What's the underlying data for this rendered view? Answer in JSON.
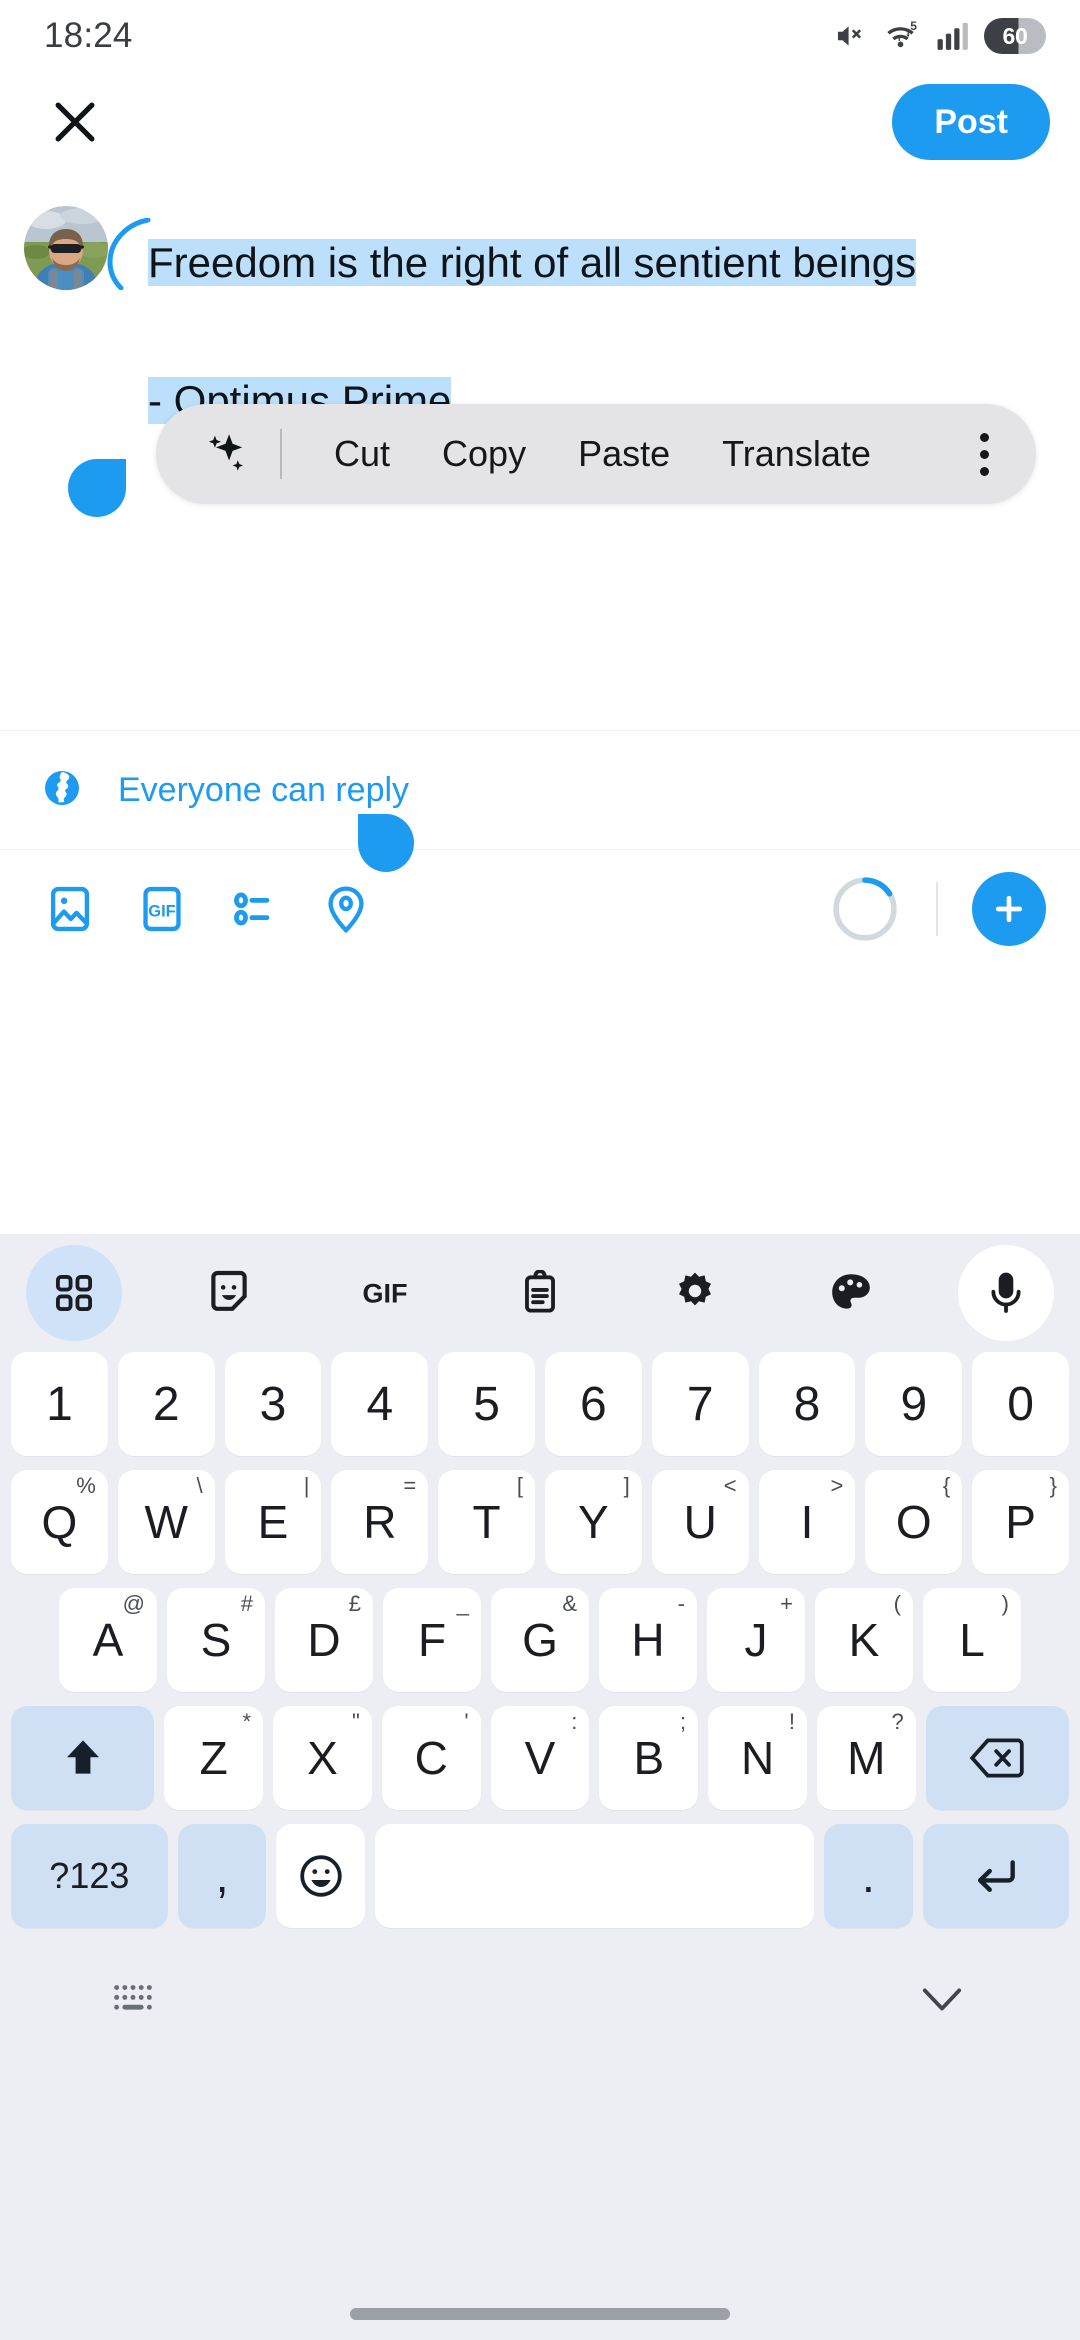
{
  "status_bar": {
    "time": "18:24",
    "battery_level": "60",
    "icons": [
      "mute-icon",
      "wifi-5g-icon",
      "signal-bars-icon",
      "battery-icon"
    ]
  },
  "header": {
    "close_label": "×",
    "post_label": "Post"
  },
  "compose": {
    "avatar_alt": "user-avatar",
    "tweet_text_line1": "Freedom is the right of all sentient beings",
    "tweet_text_line2": "- Optimus Prime",
    "selected_text": "Freedom is the right of all sentient beings\n\n- Optimus Prime",
    "selection_color": "#bcdffb",
    "handle_color": "#1d9bf0"
  },
  "selection_toolbar": {
    "ai_icon": "sparkle-icon",
    "items": [
      "Cut",
      "Copy",
      "Paste",
      "Translate"
    ],
    "overflow_icon": "more-vertical-icon",
    "background": "#e4e4e6"
  },
  "reply_settings": {
    "icon": "globe-icon",
    "label": "Everyone can reply",
    "color": "#1d9bf0"
  },
  "composer_toolbar": {
    "buttons": [
      {
        "name": "media-icon",
        "label": "Media"
      },
      {
        "name": "gif-icon",
        "label": "GIF"
      },
      {
        "name": "poll-icon",
        "label": "Poll"
      },
      {
        "name": "location-icon",
        "label": "Location"
      }
    ],
    "gif_text": "GIF",
    "progress_percent": 8,
    "add_label": "+",
    "accent": "#1d9bf0"
  },
  "keyboard": {
    "toolbar": [
      {
        "name": "apps-grid-icon",
        "active": true
      },
      {
        "name": "sticker-icon",
        "active": false
      },
      {
        "name": "gif-icon",
        "active": false,
        "text": "GIF"
      },
      {
        "name": "clipboard-icon",
        "active": false
      },
      {
        "name": "settings-gear-icon",
        "active": false
      },
      {
        "name": "theme-palette-icon",
        "active": false
      },
      {
        "name": "microphone-icon",
        "active": false
      }
    ],
    "row_numbers": [
      "1",
      "2",
      "3",
      "4",
      "5",
      "6",
      "7",
      "8",
      "9",
      "0"
    ],
    "row_q": [
      {
        "key": "Q",
        "alt": "%"
      },
      {
        "key": "W",
        "alt": "\\"
      },
      {
        "key": "E",
        "alt": "|"
      },
      {
        "key": "R",
        "alt": "="
      },
      {
        "key": "T",
        "alt": "["
      },
      {
        "key": "Y",
        "alt": "]"
      },
      {
        "key": "U",
        "alt": "<"
      },
      {
        "key": "I",
        "alt": ">"
      },
      {
        "key": "O",
        "alt": "{"
      },
      {
        "key": "P",
        "alt": "}"
      }
    ],
    "row_a": [
      {
        "key": "A",
        "alt": "@"
      },
      {
        "key": "S",
        "alt": "#"
      },
      {
        "key": "D",
        "alt": "£"
      },
      {
        "key": "F",
        "alt": "_"
      },
      {
        "key": "G",
        "alt": "&"
      },
      {
        "key": "H",
        "alt": "-"
      },
      {
        "key": "J",
        "alt": "+"
      },
      {
        "key": "K",
        "alt": "("
      },
      {
        "key": "L",
        "alt": ")"
      }
    ],
    "row_z": [
      {
        "key": "Z",
        "alt": "*"
      },
      {
        "key": "X",
        "alt": "\""
      },
      {
        "key": "C",
        "alt": "'"
      },
      {
        "key": "V",
        "alt": ":"
      },
      {
        "key": "B",
        "alt": ";"
      },
      {
        "key": "N",
        "alt": "!"
      },
      {
        "key": "M",
        "alt": "?"
      }
    ],
    "shift_icon": "shift-icon",
    "backspace_icon": "backspace-icon",
    "row_bottom": {
      "symbols_label": "?123",
      "comma_label": ",",
      "emoji_icon": "emoji-smiley-icon",
      "space_label": "",
      "period_label": ".",
      "enter_icon": "enter-return-icon"
    },
    "bottom_bar": {
      "switch_keyboard_icon": "keyboard-switch-icon",
      "hide_keyboard_icon": "chevron-down-icon"
    }
  }
}
